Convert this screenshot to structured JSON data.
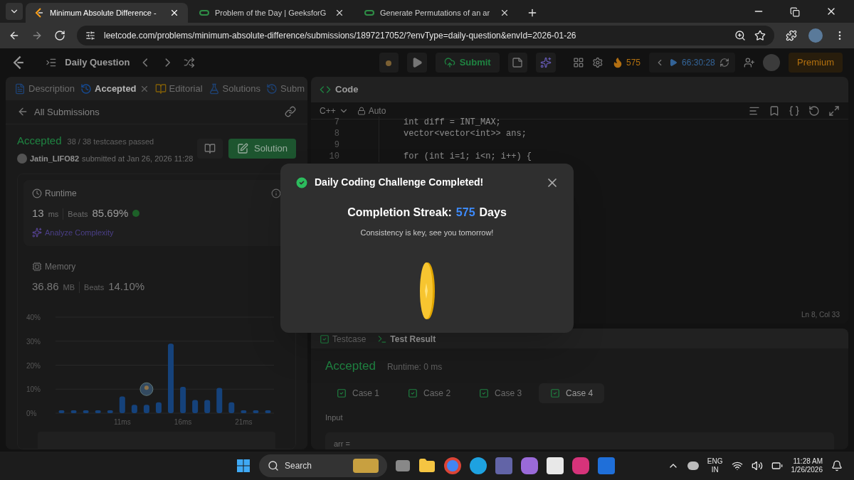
{
  "browser": {
    "tabs": [
      {
        "title": "Minimum Absolute Difference -",
        "selected": true,
        "kind": "leetcode"
      },
      {
        "title": "Problem of the Day | GeeksforG",
        "selected": false,
        "kind": "gfg"
      },
      {
        "title": "Generate Permutations of an ar",
        "selected": false,
        "kind": "gfg"
      }
    ],
    "url": "leetcode.com/problems/minimum-absolute-difference/submissions/1897217052/?envType=daily-question&envId=2026-01-26"
  },
  "nav": {
    "title": "Daily Question",
    "submit": "Submit",
    "streak": "575",
    "timer": "66:30:28",
    "premium": "Premium"
  },
  "left_panel": {
    "tabs": [
      {
        "label": "Description",
        "selected": false,
        "kind": "description"
      },
      {
        "label": "Accepted",
        "selected": true,
        "kind": "accepted"
      },
      {
        "label": "Editorial",
        "selected": false,
        "kind": "editorial"
      },
      {
        "label": "Solutions",
        "selected": false,
        "kind": "solutions"
      },
      {
        "label": "Subm",
        "selected": false,
        "kind": "submissions"
      }
    ],
    "back_link": "All Submissions",
    "status": "Accepted",
    "testcases": "38 / 38 testcases passed",
    "user": "Jatin_LIFO82",
    "submitted": "submitted at Jan 26, 2026 11:28",
    "solution_button": "Solution",
    "runtime": {
      "label": "Runtime",
      "value": "13",
      "unit": "ms",
      "beats_label": "Beats",
      "beats": "85.69%",
      "analyze": "Analyze Complexity"
    },
    "memory": {
      "label": "Memory",
      "value": "36.86",
      "unit": "MB",
      "beats_label": "Beats",
      "beats": "14.10%"
    },
    "chart_data": {
      "type": "bar",
      "x": [
        6,
        7,
        8,
        9,
        10,
        11,
        12,
        13,
        14,
        15,
        16,
        17,
        18,
        19,
        20,
        21,
        22,
        23
      ],
      "series": [
        {
          "color": "#1f5fb0",
          "values": [
            1.2,
            1.2,
            1.2,
            1.2,
            1.2,
            7,
            3.5,
            3.5,
            4.5,
            29,
            11,
            5.5,
            5.5,
            10.5,
            4.5,
            1.2,
            1.2,
            1.2
          ]
        }
      ],
      "grid": true,
      "xlim": [
        5.5,
        23.5
      ],
      "ylim": [
        0,
        40
      ],
      "yticks": [
        {
          "value": 0,
          "label": "0%"
        },
        {
          "value": 10,
          "label": "10%"
        },
        {
          "value": 20,
          "label": "20%"
        },
        {
          "value": 30,
          "label": "30%"
        },
        {
          "value": 40,
          "label": "40%"
        }
      ],
      "xticks": [
        {
          "value": 11,
          "label": "11ms"
        },
        {
          "value": 16,
          "label": "16ms"
        },
        {
          "value": 21,
          "label": "21ms"
        }
      ]
    }
  },
  "code_panel": {
    "title": "Code",
    "language": "C++",
    "mode": "Auto",
    "lines": [
      {
        "number": "7",
        "code": "int diff = INT_MAX;"
      },
      {
        "number": "8",
        "code": "vector<vector<int>> ans;"
      },
      {
        "number": "9"
      },
      {
        "number": "10",
        "code": "for (int i=1; i<n; i++) {"
      }
    ],
    "cursor": "Ln 8, Col 33"
  },
  "result_panel": {
    "tabs": [
      {
        "label": "Testcase",
        "selected": false
      },
      {
        "label": "Test Result",
        "selected": true
      }
    ],
    "status": "Accepted",
    "runtime": "Runtime: 0 ms",
    "cases": [
      {
        "label": "Case 1",
        "passed": true,
        "selected": false
      },
      {
        "label": "Case 2",
        "passed": true,
        "selected": false
      },
      {
        "label": "Case 3",
        "passed": true,
        "selected": false
      },
      {
        "label": "Case 4",
        "passed": true,
        "selected": true
      }
    ],
    "input_label": "Input",
    "input_value": "arr ="
  },
  "dialog": {
    "title": "Daily Coding Challenge Completed!",
    "streak_label": "Completion Streak:",
    "streak": "575",
    "streak_unit": "Days",
    "message": "Consistency is key, see you tomorrow!"
  },
  "taskbar": {
    "search": "Search",
    "language": "ENG",
    "region": "IN",
    "time": "11:28 AM",
    "date": "1/26/2026"
  }
}
